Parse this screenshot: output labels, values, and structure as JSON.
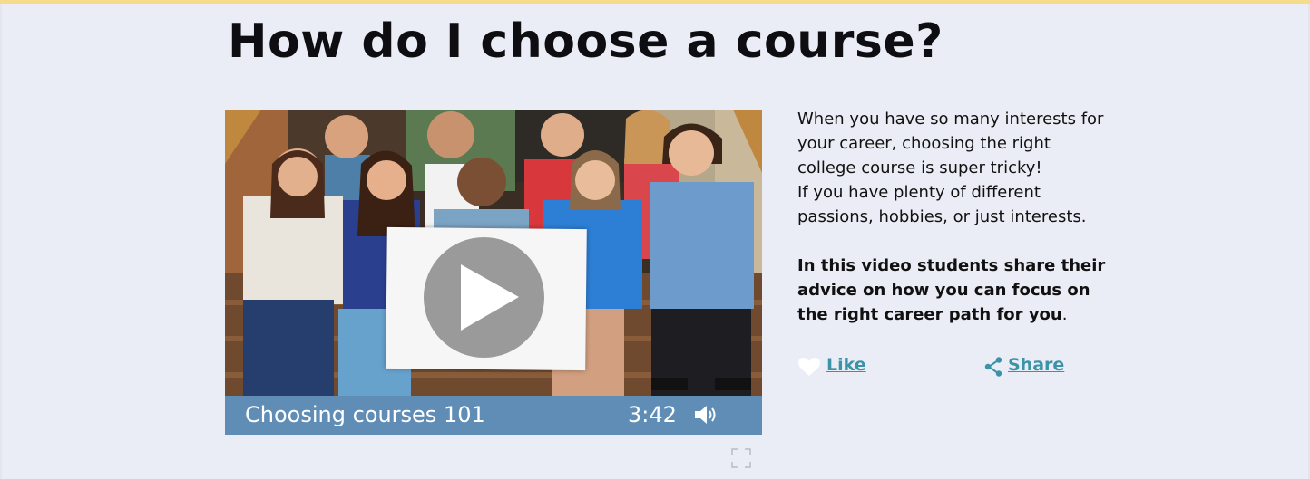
{
  "page": {
    "title": "How do I choose a course?"
  },
  "video": {
    "title": "Choosing courses 101",
    "duration": "3:42",
    "play_icon": "play-icon",
    "volume_icon": "volume-icon",
    "fullscreen_icon": "fullscreen-icon",
    "bar_color": "#5f8db6"
  },
  "description": {
    "lines": [
      "When you have so many interests for",
      "your career, choosing the right",
      "college course is super tricky!",
      "If you have plenty of different",
      "passions, hobbies, or just interests."
    ],
    "bold_lines": [
      "In this video students share their",
      "advice on how you can focus on",
      "the right career path for you"
    ],
    "bold_end": "."
  },
  "actions": {
    "like_label": "Like",
    "share_label": "Share",
    "like_icon": "heart-icon",
    "share_icon": "share-icon",
    "link_color": "#3b93a8"
  },
  "colors": {
    "top_stripe": "#f6dc8a",
    "background": "#eaedf5"
  }
}
